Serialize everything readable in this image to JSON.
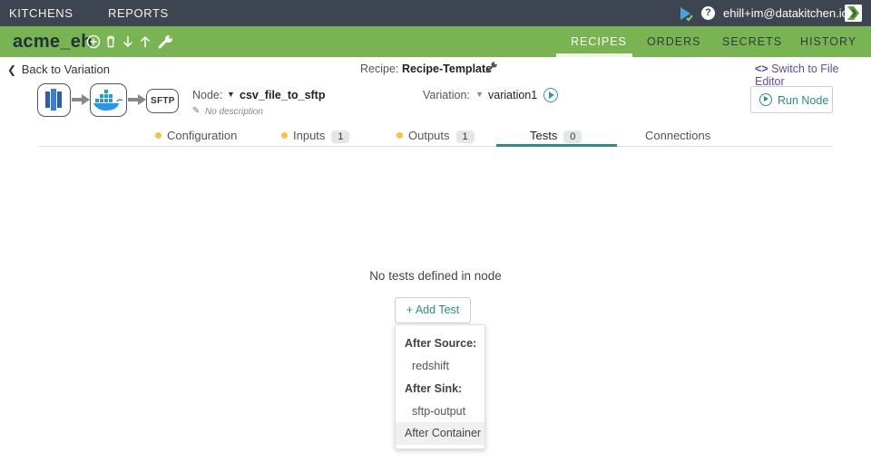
{
  "topbar": {
    "nav": [
      "KITCHENS",
      "REPORTS"
    ],
    "user": "ehill+im@datakitchen.io",
    "help": "?",
    "accent": "#3d4650"
  },
  "kitchen": {
    "name": "acme_eh",
    "tools": [
      "add-circle-icon",
      "trash-icon",
      "arrow-down-icon",
      "arrow-up-icon",
      "wrench-icon"
    ],
    "tabs": [
      "RECIPES",
      "ORDERS",
      "SECRETS",
      "HISTORY"
    ],
    "active_tab": "RECIPES",
    "color": "#78b552"
  },
  "header": {
    "back": "Back to Variation",
    "recipe_label": "Recipe:",
    "recipe_value": "Recipe-Template",
    "file_editor": "Switch to File Editor"
  },
  "node": {
    "label": "Node:",
    "value": "csv_file_to_sftp",
    "description": "No description",
    "variation_label": "Variation:",
    "variation_value": "variation1",
    "run_button": "Run Node",
    "sftp_label": "SFTP"
  },
  "subtabs": {
    "configuration": "Configuration",
    "inputs": "Inputs",
    "inputs_count": "1",
    "outputs": "Outputs",
    "outputs_count": "1",
    "tests": "Tests",
    "tests_count": "0",
    "connections": "Connections",
    "active": "Tests"
  },
  "tests": {
    "empty_message": "No tests defined in node",
    "add_button": "+ Add Test",
    "menu": {
      "after_source": "After Source:",
      "redshift": "redshift",
      "after_sink": "After Sink:",
      "sftp_output": "sftp-output",
      "after_container": "After Container"
    }
  }
}
